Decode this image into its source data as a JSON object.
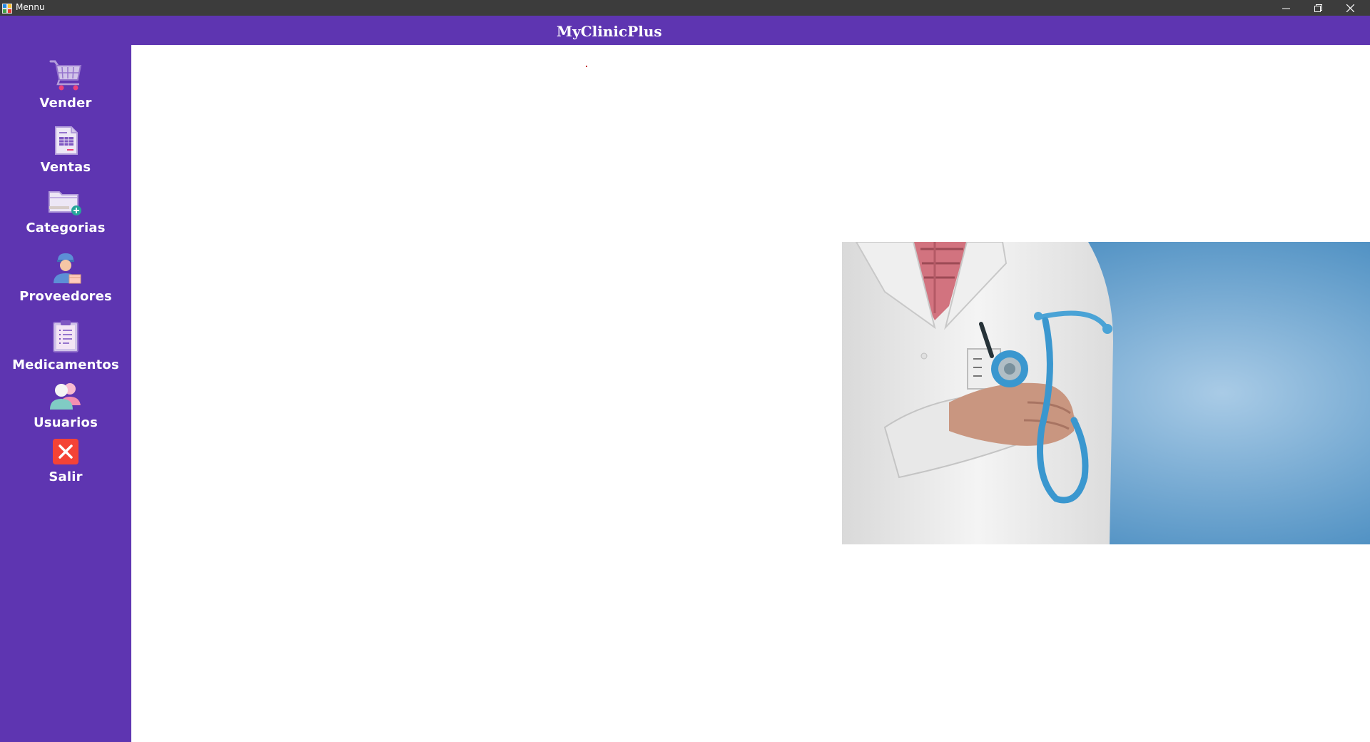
{
  "window": {
    "title": "Mennu",
    "controls": [
      "minimize-icon",
      "restore-icon",
      "close-icon"
    ]
  },
  "header": {
    "title": "MyClinicPlus"
  },
  "sidebar": {
    "items": [
      {
        "label": "Vender",
        "icon": "shopping-cart-icon"
      },
      {
        "label": "Ventas",
        "icon": "sales-document-icon"
      },
      {
        "label": "Categorias",
        "icon": "folder-add-icon"
      },
      {
        "label": "Proveedores",
        "icon": "supplier-icon"
      },
      {
        "label": "Medicamentos",
        "icon": "clipboard-list-icon"
      },
      {
        "label": "Usuarios",
        "icon": "users-icon"
      },
      {
        "label": "Salir",
        "icon": "exit-icon"
      }
    ]
  },
  "main": {
    "image": "doctor-with-stethoscope-image"
  },
  "colors": {
    "sidebar": "#5e35b1",
    "titlebar": "#3c3c3c",
    "accent_blue": "#5a9ccc"
  }
}
